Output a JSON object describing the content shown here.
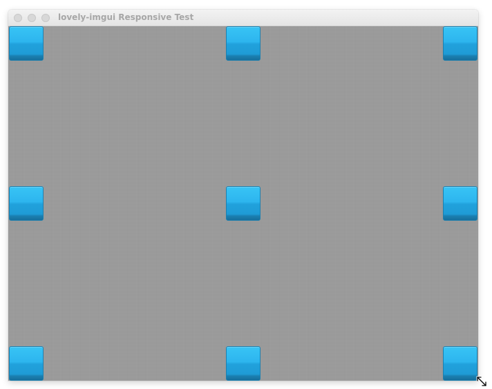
{
  "window": {
    "title": "lovely-imgui Responsive Test"
  },
  "titlebar_buttons": [
    "close-icon",
    "minimize-icon",
    "zoom-icon"
  ],
  "tiles": [
    {
      "name": "tile-top-left"
    },
    {
      "name": "tile-top-center"
    },
    {
      "name": "tile-top-right"
    },
    {
      "name": "tile-middle-left"
    },
    {
      "name": "tile-middle-center"
    },
    {
      "name": "tile-middle-right"
    },
    {
      "name": "tile-bottom-left"
    },
    {
      "name": "tile-bottom-center"
    },
    {
      "name": "tile-bottom-right"
    }
  ],
  "colors": {
    "canvas_background": "#9b9b9b",
    "tile_primary": "#2db5ee",
    "tile_dark": "#1a7fb1"
  },
  "cursor": "resize-cursor-icon"
}
